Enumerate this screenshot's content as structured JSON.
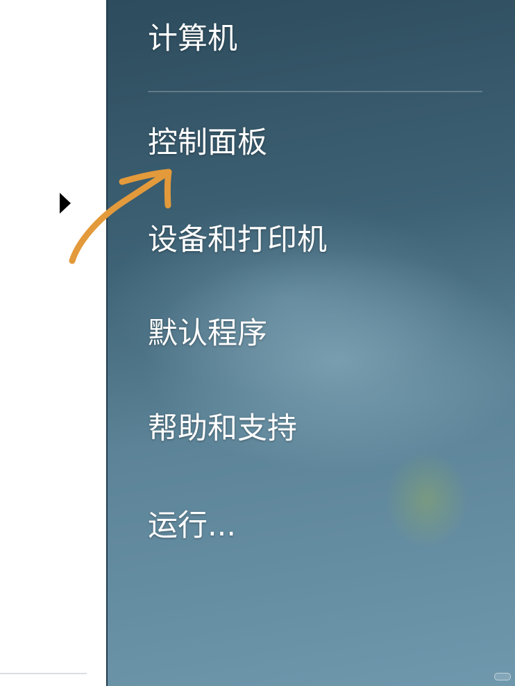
{
  "start_menu": {
    "right_pane": {
      "items": [
        {
          "label": "计算机"
        },
        {
          "label": "控制面板"
        },
        {
          "label": "设备和打印机"
        },
        {
          "label": "默认程序"
        },
        {
          "label": "帮助和支持"
        },
        {
          "label": "运行..."
        }
      ]
    },
    "left_pane": {
      "submenu_arrow_icon": "caret-right-icon"
    }
  },
  "annotation": {
    "arrow_icon": "hand-drawn-arrow-icon",
    "color": "#e39a3b"
  },
  "colors": {
    "pane_top": "#2d4c5d",
    "pane_bottom": "#6f98ad",
    "text": "#ffffff"
  }
}
